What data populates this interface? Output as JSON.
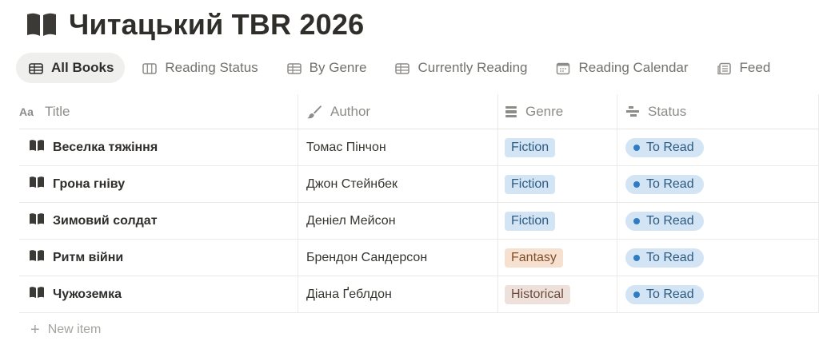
{
  "page": {
    "title": "Читацький TBR 2026",
    "icon": "open-book-icon"
  },
  "tabs": [
    {
      "label": "All Books",
      "icon": "table-icon",
      "active": true
    },
    {
      "label": "Reading Status",
      "icon": "board-icon",
      "active": false
    },
    {
      "label": "By Genre",
      "icon": "table-icon",
      "active": false
    },
    {
      "label": "Currently Reading",
      "icon": "table-icon",
      "active": false
    },
    {
      "label": "Reading Calendar",
      "icon": "calendar-icon",
      "active": false
    },
    {
      "label": "Feed",
      "icon": "feed-icon",
      "active": false
    }
  ],
  "columns": {
    "title": {
      "label": "Title",
      "icon": "text-property-icon"
    },
    "author": {
      "label": "Author",
      "icon": "brush-icon"
    },
    "genre": {
      "label": "Genre",
      "icon": "select-property-icon"
    },
    "status": {
      "label": "Status",
      "icon": "status-property-icon"
    }
  },
  "rows": [
    {
      "title": "Веселка тяжіння",
      "author": "Томас Пінчон",
      "genre": "Fiction",
      "status": "To Read"
    },
    {
      "title": "Грона гніву",
      "author": "Джон Стейнбек",
      "genre": "Fiction",
      "status": "To Read"
    },
    {
      "title": "Зимовий солдат",
      "author": "Деніел Мейсон",
      "genre": "Fiction",
      "status": "To Read"
    },
    {
      "title": "Ритм війни",
      "author": "Брендон Сандерсон",
      "genre": "Fantasy",
      "status": "To Read"
    },
    {
      "title": "Чужоземка",
      "author": "Діана Ґеблдон",
      "genre": "Historical",
      "status": "To Read"
    }
  ],
  "new_item": {
    "label": "New item",
    "icon": "plus-icon"
  },
  "colors": {
    "fiction_tag": "#d3e5f4",
    "fantasy_tag": "#f6e1d1",
    "historical_tag": "#eee0da",
    "status_dot": "#2f7cc2"
  }
}
